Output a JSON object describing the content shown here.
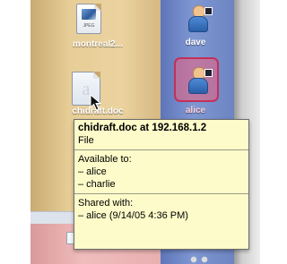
{
  "files": [
    {
      "name": "montreal2...",
      "type_tag": "JPEG",
      "icon": "jpeg-file-icon"
    },
    {
      "name": "chidraft.doc",
      "icon": "doc-file-icon"
    }
  ],
  "users": [
    {
      "name": "dave",
      "icon": "user-icon",
      "selected": false
    },
    {
      "name": "alice",
      "icon": "user-icon",
      "selected": true
    }
  ],
  "tooltip": {
    "title": "chidraft.doc at 192.168.1.2",
    "kind": "File",
    "available_label": "Available to:",
    "available_to": [
      "– alice",
      "– charlie"
    ],
    "shared_label": "Shared with:",
    "shared_with": [
      "– alice (9/14/05 4:36 PM)"
    ]
  },
  "colors": {
    "left_column": "#e7cd97",
    "right_column": "#7f97d2",
    "selection": "#c2305a",
    "tooltip_bg": "#fdfbc9"
  }
}
